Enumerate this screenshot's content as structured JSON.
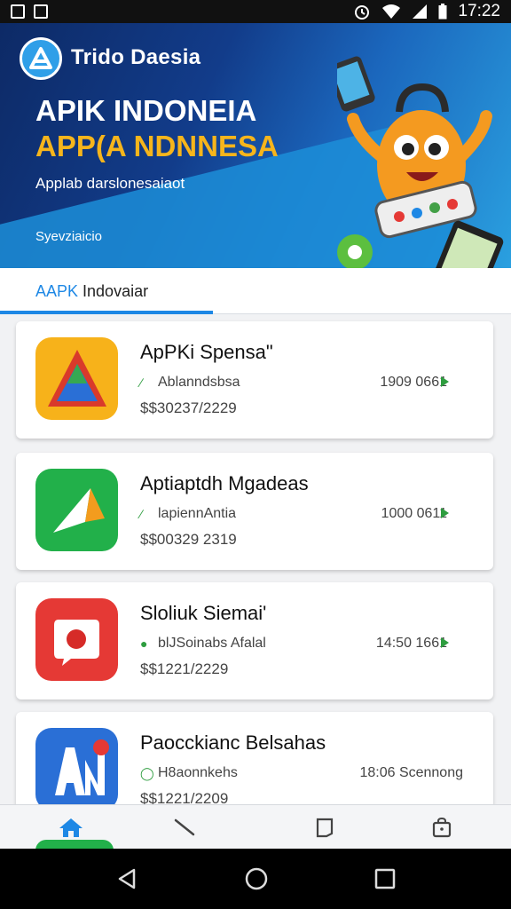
{
  "status_bar": {
    "time": "17:22"
  },
  "banner": {
    "logo_text": "Trido Daesia",
    "headline_1": "APIK INDONEIA",
    "headline_2": "APP(A NDNNESA",
    "subtitle": "Applab darslonesaiaot",
    "small_text": "Syevziaicio"
  },
  "section": {
    "title_accent": "AAPK",
    "title_rest": " Indovaiar"
  },
  "apps": [
    {
      "name": "ApPKi Spensa\"",
      "developer": "Ablanndsbsa",
      "meta": "1909 0661",
      "price": "$$30237/2229",
      "icon": "red-triangle-icon"
    },
    {
      "name": "Aptiaptdh Mgadeas",
      "developer": "lapiennAntia",
      "meta": "1000 0611",
      "price": "$$00329 2319",
      "icon": "green-arrow-icon"
    },
    {
      "name": "Sloliuk Siemai'",
      "developer": "blJSoinabs Afalal",
      "meta": "14:50 1661",
      "price": "$$1221/2229",
      "icon": "red-camera-icon"
    },
    {
      "name": "Paocckianc Belsahas",
      "developer": "H8aonnkehs",
      "meta": "18:06 Scennong",
      "price": "$$1221/2209",
      "icon": "blue-letter-icon"
    }
  ],
  "bottom_nav": [
    {
      "name": "home",
      "active": true
    },
    {
      "name": "back-slash"
    },
    {
      "name": "bookmark"
    },
    {
      "name": "bag"
    }
  ],
  "colors": {
    "accent": "#1e88e5",
    "banner_dark": "#0d2a66",
    "headline_yellow": "#f6b51c",
    "green": "#2e9d3f"
  }
}
